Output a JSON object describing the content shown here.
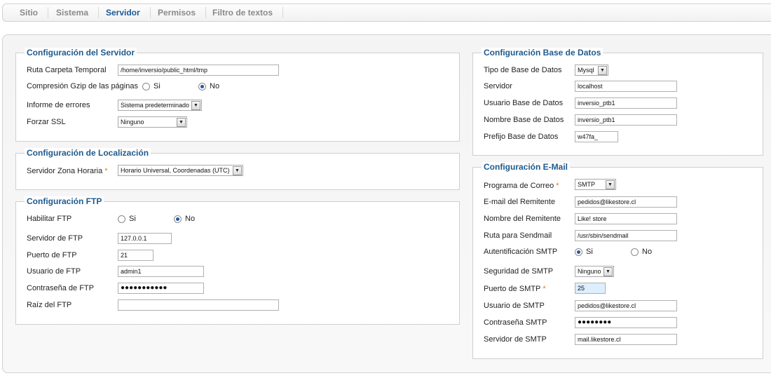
{
  "tabs": [
    "Sitio",
    "Sistema",
    "Servidor",
    "Permisos",
    "Filtro de textos"
  ],
  "server": {
    "legend": "Configuración del Servidor",
    "temp_path_label": "Ruta Carpeta Temporal",
    "temp_path_value": "/home/inversio/public_html/tmp",
    "gzip_label": "Compresión Gzip de las páginas",
    "gzip_yes": "Si",
    "gzip_no": "No",
    "error_label": "Informe de errores",
    "error_value": "Sistema predeterminado",
    "ssl_label": "Forzar SSL",
    "ssl_value": "Ninguno"
  },
  "locale": {
    "legend": "Configuración de Localización",
    "tz_label": "Servidor Zona Horaria",
    "tz_required": "*",
    "tz_value": "Horario Universal, Coordenadas (UTC)"
  },
  "ftp": {
    "legend": "Configuración FTP",
    "enable_label": "Habilitar FTP",
    "enable_yes": "Si",
    "enable_no": "No",
    "host_label": "Servidor de FTP",
    "host_value": "127.0.0.1",
    "port_label": "Puerto de FTP",
    "port_value": "21",
    "user_label": "Usuario de FTP",
    "user_value": "admin1",
    "pass_label": "Contraseña de FTP",
    "pass_value": "●●●●●●●●●●●",
    "root_label": "Raíz del FTP",
    "root_value": ""
  },
  "db": {
    "legend": "Configuración Base de Datos",
    "type_label": "Tipo de Base de Datos",
    "type_value": "Mysql",
    "host_label": "Servidor",
    "host_value": "localhost",
    "user_label": "Usuario Base de Datos",
    "user_value": "inversio_ptb1",
    "name_label": "Nombre Base de Datos",
    "name_value": "inversio_ptb1",
    "prefix_label": "Prefijo Base de Datos",
    "prefix_value": "w47fa_"
  },
  "mail": {
    "legend": "Configuración E-Mail",
    "mailer_label": "Programa de Correo",
    "mailer_required": "*",
    "mailer_value": "SMTP",
    "from_label": "E-mail del Remitente",
    "from_value": "pedidos@likestore.cl",
    "fromname_label": "Nombre del Remitente",
    "fromname_value": "Like! store",
    "sendmail_label": "Ruta para Sendmail",
    "sendmail_value": "/usr/sbin/sendmail",
    "auth_label": "Autentificación SMTP",
    "auth_yes": "Si",
    "auth_no": "No",
    "secure_label": "Seguridad de SMTP",
    "secure_value": "Ninguno",
    "port_label": "Puerto de SMTP",
    "port_required": "*",
    "port_value": "25",
    "user_label": "Usuario de SMTP",
    "user_value": "pedidos@likestore.cl",
    "pass_label": "Contraseña SMTP",
    "pass_value": "●●●●●●●●",
    "host_label": "Servidor de SMTP",
    "host_value": "mail.likestore.cl"
  }
}
